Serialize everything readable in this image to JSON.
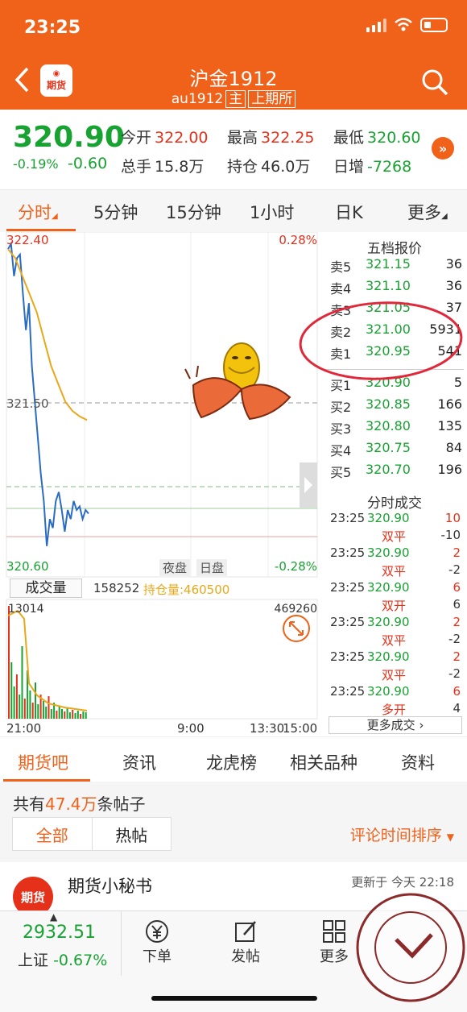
{
  "status": {
    "time": "23:25"
  },
  "header": {
    "logo_text": "期货",
    "title": "沪金1912",
    "contract": "au1912",
    "tag_main": "主",
    "tag_exchange": "上期所"
  },
  "quote": {
    "price": "320.90",
    "change_pct": "-0.19%",
    "change": "-0.60",
    "open_label": "今开",
    "open": "322.00",
    "high_label": "最高",
    "high": "322.25",
    "low_label": "最低",
    "low": "320.60",
    "volume_label": "总手",
    "volume": "15.8万",
    "oi_label": "持仓",
    "oi": "46.0万",
    "daily_inc_label": "日增",
    "daily_inc": "-7268"
  },
  "tabs": [
    {
      "label": "分时"
    },
    {
      "label": "5分钟"
    },
    {
      "label": "15分钟"
    },
    {
      "label": "1小时"
    },
    {
      "label": "日K"
    },
    {
      "label": "更多"
    }
  ],
  "chart": {
    "y_top": "322.40",
    "y_top_pct": "0.28%",
    "y_mid": "321.50",
    "y_bottom": "320.60",
    "y_bottom_pct": "-0.28%",
    "session_night": "夜盘",
    "session_day": "日盘",
    "volume_tab": "成交量",
    "volume_value": "158252",
    "oi_text": "持仓量:460500",
    "vol_left_top": "13014",
    "vol_right_top": "469260",
    "time_labels": [
      "21:00",
      "9:00",
      "13:30",
      "15:00"
    ]
  },
  "chart_data": {
    "type": "line",
    "series": [
      {
        "values": [
          322.35,
          322.38,
          322.2,
          322.3,
          322.32,
          322.1,
          321.9,
          322.05,
          321.7,
          321.5,
          321.3,
          321.1,
          320.95,
          320.7,
          320.85,
          320.8,
          320.95,
          321.0,
          320.9,
          320.78,
          320.9,
          320.85,
          320.95,
          320.9,
          320.92,
          320.85,
          320.9,
          320.88
        ]
      },
      {
        "values": [
          322.35,
          322.3,
          322.2,
          322.1,
          322.0,
          321.85,
          321.7,
          321.6,
          321.5,
          321.45,
          321.42,
          321.4
        ]
      }
    ],
    "ylim": [
      320.6,
      322.4
    ]
  },
  "order_book": {
    "title": "五档报价",
    "asks": [
      {
        "label": "卖5",
        "price": "321.15",
        "qty": "36"
      },
      {
        "label": "卖4",
        "price": "321.10",
        "qty": "36"
      },
      {
        "label": "卖3",
        "price": "321.05",
        "qty": "37"
      },
      {
        "label": "卖2",
        "price": "321.00",
        "qty": "5931"
      },
      {
        "label": "卖1",
        "price": "320.95",
        "qty": "541"
      }
    ],
    "bids": [
      {
        "label": "买1",
        "price": "320.90",
        "qty": "5"
      },
      {
        "label": "买2",
        "price": "320.85",
        "qty": "166"
      },
      {
        "label": "买3",
        "price": "320.80",
        "qty": "135"
      },
      {
        "label": "买4",
        "price": "320.75",
        "qty": "84"
      },
      {
        "label": "买5",
        "price": "320.70",
        "qty": "196"
      }
    ]
  },
  "time_sales": {
    "title": "分时成交",
    "rows": [
      {
        "time": "23:25",
        "price": "320.90",
        "vol": "10",
        "action": "双平",
        "change": "-10"
      },
      {
        "time": "23:25",
        "price": "320.90",
        "vol": "2",
        "action": "双平",
        "change": "-2"
      },
      {
        "time": "23:25",
        "price": "320.90",
        "vol": "6",
        "action": "双开",
        "change": "6"
      },
      {
        "time": "23:25",
        "price": "320.90",
        "vol": "2",
        "action": "双平",
        "change": "-2"
      },
      {
        "time": "23:25",
        "price": "320.90",
        "vol": "2",
        "action": "双平",
        "change": "-2"
      },
      {
        "time": "23:25",
        "price": "320.90",
        "vol": "6",
        "action": "多开",
        "change": "4"
      }
    ],
    "more_label": "更多成交"
  },
  "bottom_tabs": [
    {
      "label": "期货吧"
    },
    {
      "label": "资讯"
    },
    {
      "label": "龙虎榜"
    },
    {
      "label": "相关品种"
    },
    {
      "label": "资料"
    }
  ],
  "forum": {
    "count_prefix": "共有",
    "count_value": "47.4万",
    "count_suffix": "条帖子",
    "filter_all": "全部",
    "filter_hot": "热帖",
    "sort_label": "评论时间排序",
    "post_author": "期货小秘书",
    "post_updated": "更新于 今天 22:18",
    "avatar_text": "期货"
  },
  "toolbar": {
    "index_value": "2932.51",
    "index_name": "上证",
    "index_change": "-0.67%",
    "order_label": "下单",
    "post_label": "发帖",
    "more_label": "更多"
  },
  "colors": {
    "brand": "#f0611a",
    "up": "#e5301a",
    "down": "#18a232"
  }
}
